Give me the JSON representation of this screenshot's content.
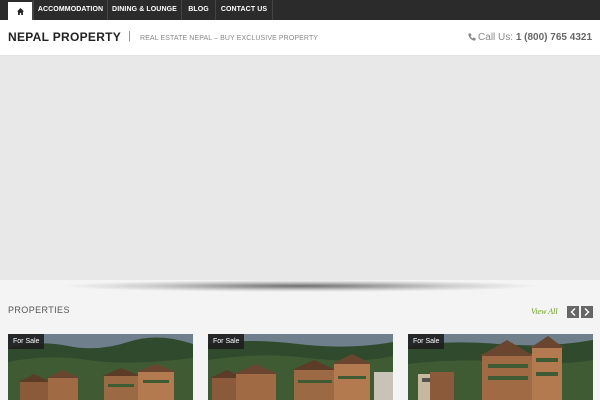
{
  "nav": {
    "home_icon": "home-icon",
    "items": [
      "ACCOMMODATION",
      "DINING & LOUNGE",
      "BLOG",
      "CONTACT US"
    ]
  },
  "header": {
    "site_title": "NEPAL PROPERTY",
    "separator": "|",
    "tagline": "REAL ESTATE NEPAL – BUY EXCLUSIVE PROPERTY",
    "phone_label": "Call Us:",
    "phone_number": "1 (800) 765 4321",
    "phone_icon": "phone-icon"
  },
  "properties": {
    "title": "PROPERTIES",
    "view_all": "View All",
    "prev_icon": "chevron-left-icon",
    "next_icon": "chevron-right-icon",
    "cards": [
      {
        "badge": "For Sale"
      },
      {
        "badge": "For Sale"
      },
      {
        "badge": "For Sale"
      }
    ]
  },
  "colors": {
    "nav_bg": "#2b2b2b",
    "accent_green": "#6aa121",
    "slider_bg": "#e8e8e8"
  }
}
